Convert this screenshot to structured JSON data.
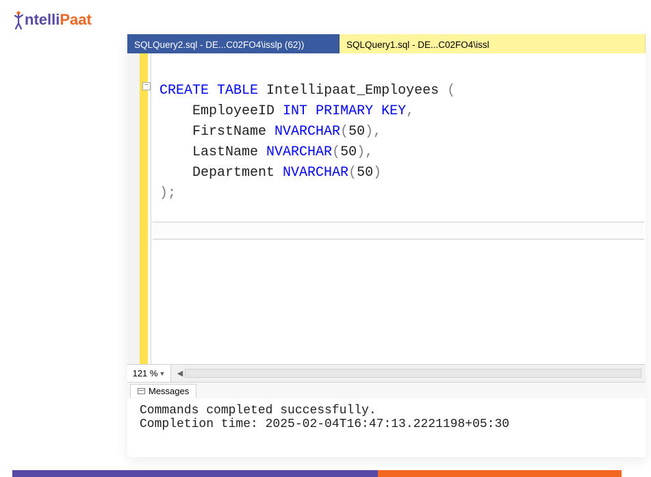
{
  "logo_parts": {
    "prefix": "",
    "intelli": "ntelli",
    "paat": "Paat"
  },
  "tabs": [
    {
      "label": "SQLQuery2.sql - DE...C02FO4\\isslp (62))",
      "active": true
    },
    {
      "label": "SQLQuery1.sql - DE...C02FO4\\issl",
      "active": false
    }
  ],
  "code": {
    "tokens": [
      [
        {
          "c": "kw",
          "t": "CREATE"
        },
        {
          "c": "",
          "t": " "
        },
        {
          "c": "kw",
          "t": "TABLE"
        },
        {
          "c": "",
          "t": " Intellipaat_Employees "
        },
        {
          "c": "grey",
          "t": "("
        }
      ],
      [
        {
          "c": "",
          "t": "    EmployeeID "
        },
        {
          "c": "ty",
          "t": "INT"
        },
        {
          "c": "",
          "t": " "
        },
        {
          "c": "ty",
          "t": "PRIMARY"
        },
        {
          "c": "",
          "t": " "
        },
        {
          "c": "ty",
          "t": "KEY"
        },
        {
          "c": "grey",
          "t": ","
        }
      ],
      [
        {
          "c": "",
          "t": "    FirstName "
        },
        {
          "c": "ty",
          "t": "NVARCHAR"
        },
        {
          "c": "grey",
          "t": "("
        },
        {
          "c": "num",
          "t": "50"
        },
        {
          "c": "grey",
          "t": "),"
        }
      ],
      [
        {
          "c": "",
          "t": "    LastName "
        },
        {
          "c": "ty",
          "t": "NVARCHAR"
        },
        {
          "c": "grey",
          "t": "("
        },
        {
          "c": "num",
          "t": "50"
        },
        {
          "c": "grey",
          "t": "),"
        }
      ],
      [
        {
          "c": "",
          "t": "    Department "
        },
        {
          "c": "ty",
          "t": "NVARCHAR"
        },
        {
          "c": "grey",
          "t": "("
        },
        {
          "c": "num",
          "t": "50"
        },
        {
          "c": "grey",
          "t": ")"
        }
      ],
      [
        {
          "c": "grey",
          "t": ");"
        }
      ]
    ]
  },
  "zoom": "121 %",
  "messages_tab_label": "Messages",
  "output": {
    "line1": "Commands completed successfully.",
    "line2": "",
    "line3": "Completion time: 2025-02-04T16:47:13.2221198+05:30"
  }
}
